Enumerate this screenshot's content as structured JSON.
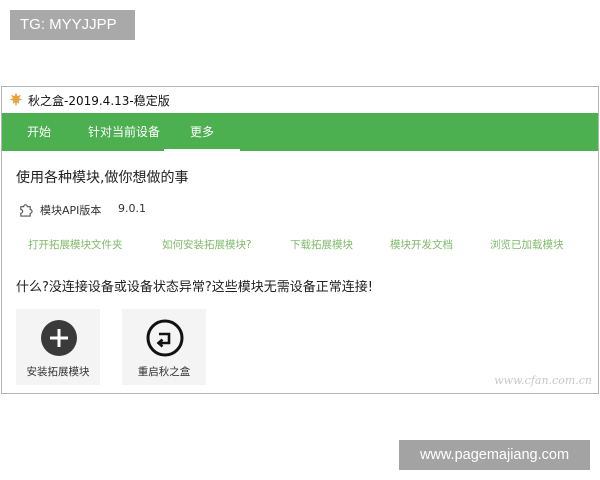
{
  "overlay": {
    "tg_label": "TG: MYYJJPP",
    "site_label": "www.pagemajiang.com"
  },
  "window": {
    "title": "秋之盒-2019.4.13-稳定版"
  },
  "nav": {
    "tabs": [
      {
        "label": "开始"
      },
      {
        "label": "针对当前设备"
      },
      {
        "label": "更多",
        "active": true
      }
    ]
  },
  "main": {
    "heading": "使用各种模块,做你想做的事",
    "api": {
      "label": "模块API版本",
      "version": "9.0.1"
    },
    "links": [
      "打开拓展模块文件夹",
      "如何安装拓展模块?",
      "下载拓展模块",
      "模块开发文档",
      "浏览已加载模块"
    ],
    "subheading": "什么?没连接设备或设备状态异常?这些模块无需设备正常连接!",
    "tiles": [
      {
        "label": "安装拓展模块",
        "icon": "plus-icon"
      },
      {
        "label": "重启秋之盒",
        "icon": "restart-icon"
      }
    ],
    "watermark": "www.cfan.com.cn"
  },
  "colors": {
    "nav_green": "#4caf50",
    "link_green": "#7fba6a",
    "badge_gray": "#a9a9a9"
  }
}
